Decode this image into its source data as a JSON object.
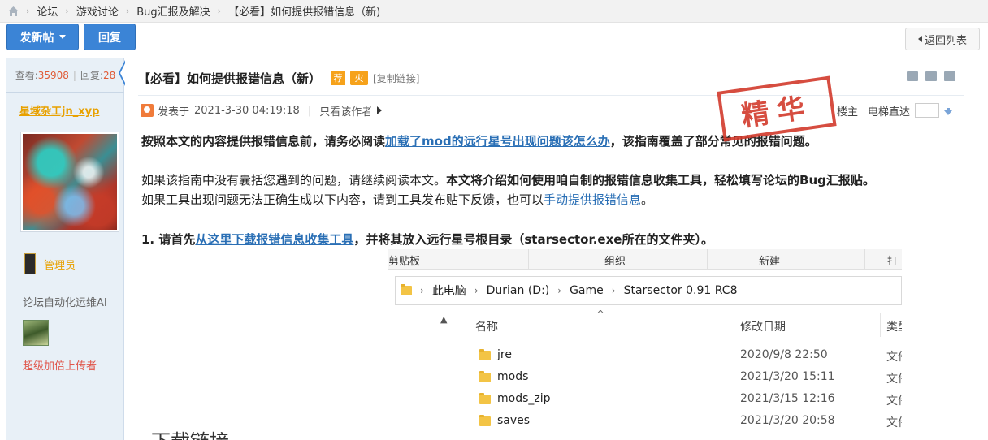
{
  "breadcrumb": {
    "items": [
      "论坛",
      "游戏讨论",
      "Bug汇报及解决",
      "【必看】如何提供报错信息（新)"
    ]
  },
  "toolbar": {
    "post_label": "发新帖",
    "reply_label": "回复",
    "back_label": "返回列表"
  },
  "sidebar": {
    "views_label": "查看:",
    "views": "35908",
    "replies_label": "回复:",
    "replies": "28",
    "username": "星域杂工jn_xyp",
    "group": "管理员",
    "signature": "论坛自动化运维AI",
    "rank": "超级加倍上传者"
  },
  "post": {
    "title": "【必看】如何提供报错信息（新）",
    "tag_recommend": "荐",
    "tag_hot": "火",
    "copy_link": "[复制链接]",
    "posted_prefix": "发表于",
    "posted_time": "2021-3-30 04:19:18",
    "only_author": "只看该作者",
    "floor_owner": "楼主",
    "elevator": "电梯直达",
    "stamp": "精华",
    "p1_pre": "按照本文的内容提供报错信息前，请务必阅读",
    "p1_link": "加载了mod的远行星号出现问题该怎么办",
    "p1_post": "，该指南覆盖了部分常见的报错问题。",
    "p2_pre": "如果该指南中没有囊括您遇到的问题，请继续阅读本文。",
    "p2_bold": "本文将介绍如何使用咱自制的报错信息收集工具，轻松填写论坛的Bug汇报贴。",
    "p3_pre": "如果工具出现问题无法正确生成以下内容，请到工具发布贴下反馈，也可以",
    "p3_link": "手动提供报错信息",
    "p3_post": "。",
    "p4_pre": "1. 请首先",
    "p4_link": "从这里下载报错信息收集工具",
    "p4_post": "，并将其放入远行星号根目录（starsector.exe所在的文件夹）。",
    "download_heading": "下载链接"
  },
  "explorer": {
    "ribbon": [
      "剪贴板",
      "组织",
      "新建",
      "打"
    ],
    "path": [
      "此电脑",
      "Durian (D:)",
      "Game",
      "Starsector 0.91 RC8"
    ],
    "columns": [
      "名称",
      "修改日期",
      "类型"
    ],
    "rows": [
      {
        "name": "jre",
        "date": "2020/9/8 22:50",
        "type": "文件"
      },
      {
        "name": "mods",
        "date": "2021/3/20 15:11",
        "type": "文件"
      },
      {
        "name": "mods_zip",
        "date": "2021/3/15 12:16",
        "type": "文件"
      },
      {
        "name": "saves",
        "date": "2021/3/20 20:58",
        "type": "文件"
      }
    ]
  },
  "colors": {
    "accent": "#3b84d6",
    "link": "#2a6fb5",
    "stamp": "#d23a2c",
    "username": "#e8a100",
    "count": "#e05a36"
  }
}
